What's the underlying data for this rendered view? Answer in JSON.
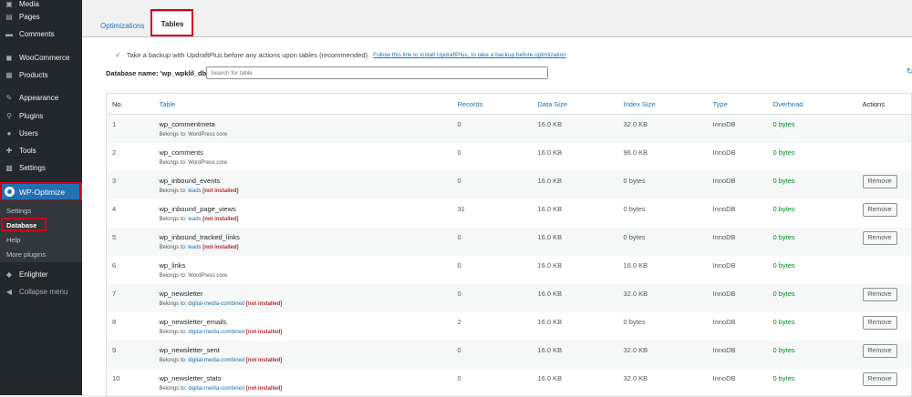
{
  "sidebar": {
    "items": [
      {
        "label": "Media",
        "icon": "media-icon"
      },
      {
        "label": "Pages",
        "icon": "pages-icon"
      },
      {
        "label": "Comments",
        "icon": "comments-icon"
      },
      {
        "label": "WooCommerce",
        "icon": "woocommerce-icon"
      },
      {
        "label": "Products",
        "icon": "products-icon"
      },
      {
        "label": "Appearance",
        "icon": "appearance-icon"
      },
      {
        "label": "Plugins",
        "icon": "plugins-icon"
      },
      {
        "label": "Users",
        "icon": "users-icon"
      },
      {
        "label": "Tools",
        "icon": "tools-icon"
      },
      {
        "label": "Settings",
        "icon": "settings-icon"
      }
    ],
    "active": {
      "label": "WP-Optimize",
      "icon": "wp-optimize-icon"
    },
    "submenu": [
      "Settings",
      "Database",
      "Help",
      "More plugins"
    ],
    "submenu_active": "Database",
    "after": [
      {
        "label": "Enlighter",
        "icon": "enlighter-icon"
      },
      {
        "label": "Collapse menu",
        "icon": "collapse-icon"
      }
    ]
  },
  "tabs": {
    "optimizations": "Optimizations",
    "tables": "Tables"
  },
  "backup": {
    "checked": true,
    "text": "Take a backup with UpdraftPlus before any actions upon tables (recommended).",
    "link": "Follow this link to install UpdraftPlus, to take a backup before optimization"
  },
  "database": {
    "label": "Database name: 'wp_wpklil_db0'",
    "search_placeholder": "Search for table"
  },
  "table": {
    "headers": {
      "no": "No.",
      "table": "Table",
      "records": "Records",
      "data_size": "Data Size",
      "index_size": "Index Size",
      "type": "Type",
      "overhead": "Overhead",
      "actions": "Actions"
    },
    "belongs_prefix": "Belongs to:",
    "not_installed": "[not installed]",
    "remove_label": "Remove",
    "rows": [
      {
        "no": "1",
        "name": "wp_commentmeta",
        "owner": "WordPress core",
        "owner_link": false,
        "not_installed": false,
        "records": "0",
        "data_size": "16.0 KB",
        "index_size": "32.0 KB",
        "type": "InnoDB",
        "overhead": "0 bytes",
        "removable": false
      },
      {
        "no": "2",
        "name": "wp_comments",
        "owner": "WordPress core",
        "owner_link": false,
        "not_installed": false,
        "records": "0",
        "data_size": "16.0 KB",
        "index_size": "96.0 KB",
        "type": "InnoDB",
        "overhead": "0 bytes",
        "removable": false
      },
      {
        "no": "3",
        "name": "wp_inbound_events",
        "owner": "leads",
        "owner_link": true,
        "not_installed": true,
        "records": "0",
        "data_size": "16.0 KB",
        "index_size": "0 bytes",
        "type": "InnoDB",
        "overhead": "0 bytes",
        "removable": true
      },
      {
        "no": "4",
        "name": "wp_inbound_page_views",
        "owner": "leads",
        "owner_link": true,
        "not_installed": true,
        "records": "31",
        "data_size": "16.0 KB",
        "index_size": "0 bytes",
        "type": "InnoDB",
        "overhead": "0 bytes",
        "removable": true
      },
      {
        "no": "5",
        "name": "wp_inbound_tracked_links",
        "owner": "leads",
        "owner_link": true,
        "not_installed": true,
        "records": "0",
        "data_size": "16.0 KB",
        "index_size": "0 bytes",
        "type": "InnoDB",
        "overhead": "0 bytes",
        "removable": true
      },
      {
        "no": "6",
        "name": "wp_links",
        "owner": "WordPress core",
        "owner_link": false,
        "not_installed": false,
        "records": "0",
        "data_size": "16.0 KB",
        "index_size": "16.0 KB",
        "type": "InnoDB",
        "overhead": "0 bytes",
        "removable": false
      },
      {
        "no": "7",
        "name": "wp_newsletter",
        "owner": "digital-media-combined",
        "owner_link": true,
        "not_installed": true,
        "records": "0",
        "data_size": "16.0 KB",
        "index_size": "32.0 KB",
        "type": "InnoDB",
        "overhead": "0 bytes",
        "removable": true
      },
      {
        "no": "8",
        "name": "wp_newsletter_emails",
        "owner": "digital-media-combined",
        "owner_link": true,
        "not_installed": true,
        "records": "2",
        "data_size": "16.0 KB",
        "index_size": "0 bytes",
        "type": "InnoDB",
        "overhead": "0 bytes",
        "removable": true
      },
      {
        "no": "9",
        "name": "wp_newsletter_sent",
        "owner": "digital-media-combined",
        "owner_link": true,
        "not_installed": true,
        "records": "0",
        "data_size": "16.0 KB",
        "index_size": "32.0 KB",
        "type": "InnoDB",
        "overhead": "0 bytes",
        "removable": true
      },
      {
        "no": "10",
        "name": "wp_newsletter_stats",
        "owner": "digital-media-combined",
        "owner_link": true,
        "not_installed": true,
        "records": "0",
        "data_size": "16.0 KB",
        "index_size": "32.0 KB",
        "type": "InnoDB",
        "overhead": "0 bytes",
        "removable": true
      }
    ]
  },
  "colors": {
    "accent": "#2271b1",
    "sidebar": "#23282d",
    "highlight": "#d0021b",
    "overhead": "#008a20",
    "not_installed": "#b32d2e"
  }
}
